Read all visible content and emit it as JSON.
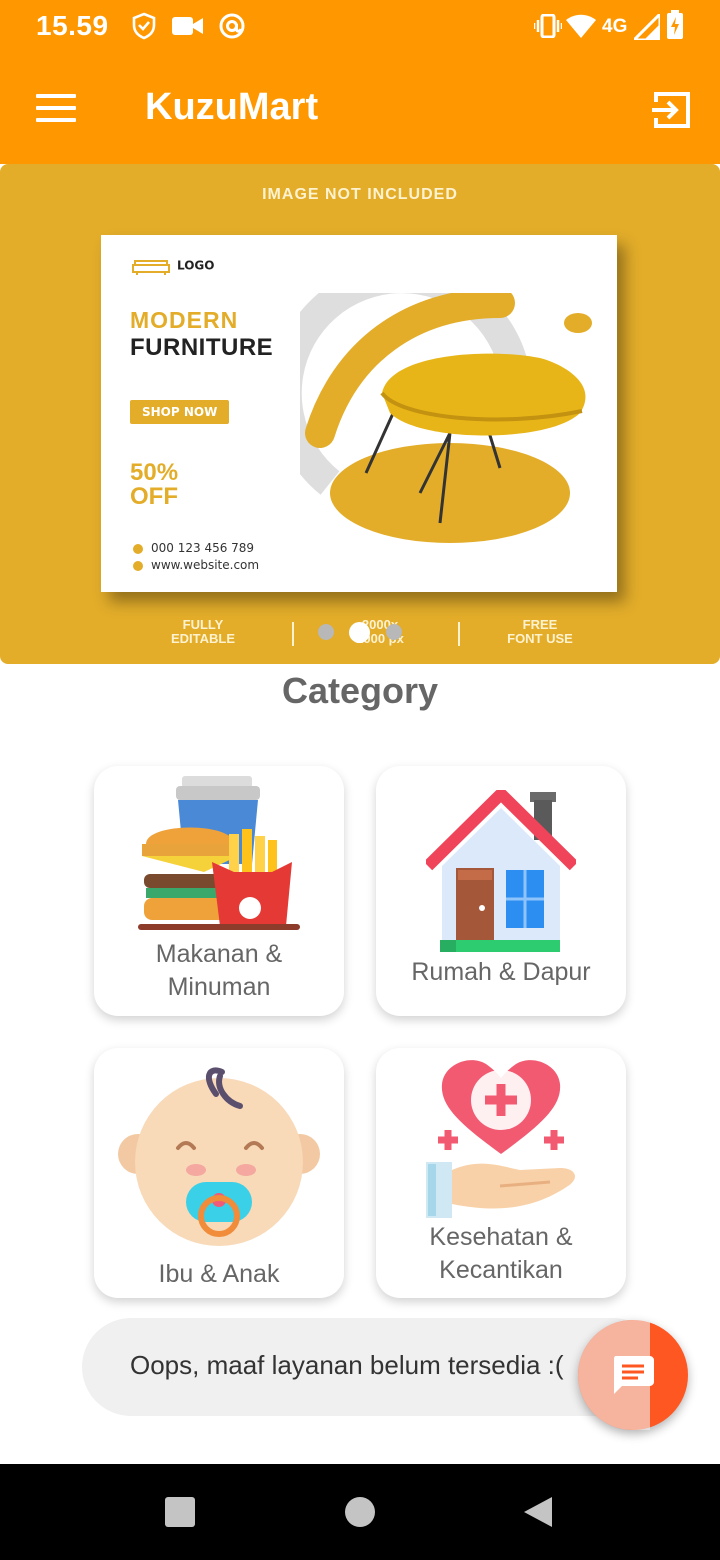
{
  "status_bar": {
    "time": "15.59",
    "network": "4G",
    "icons": [
      "shield-icon",
      "video-camera-icon",
      "at-sign-icon",
      "vibrate-icon",
      "wifi-icon",
      "signal-icon",
      "battery-charging-icon"
    ]
  },
  "app_bar": {
    "title": "KuzuMart",
    "menu_icon": "hamburger-menu-icon",
    "action_icon": "exit-to-app-icon"
  },
  "banner": {
    "top_text": "IMAGE NOT INCLUDED",
    "logo_text": "LOGO",
    "headline_1": "MODERN",
    "headline_2": "FURNITURE",
    "shop_button": "SHOP NOW",
    "discount_1": "50%",
    "discount_2": "OFF",
    "phone": "000 123 456 789",
    "website": "www.website.com",
    "footer_left": [
      "FULLY",
      "EDITABLE"
    ],
    "footer_mid": [
      "2000x",
      "2000 px"
    ],
    "footer_right": [
      "FREE",
      "FONT USE"
    ],
    "accent_color": "#e3ad2a",
    "slide_count": 3,
    "active_slide": 2
  },
  "category": {
    "title": "Category",
    "items": [
      {
        "label_1": "Makanan &",
        "label_2": "Minuman",
        "icon": "food-drink-icon"
      },
      {
        "label_1": "Rumah & Dapur",
        "label_2": "",
        "icon": "house-icon"
      },
      {
        "label_1": "Ibu & Anak",
        "label_2": "",
        "icon": "baby-icon"
      },
      {
        "label_1": "Kesehatan &",
        "label_2": "Kecantikan",
        "icon": "health-heart-icon"
      }
    ]
  },
  "toast": {
    "message": "Oops, maaf layanan belum tersedia :("
  },
  "fab": {
    "icon": "chat-message-icon",
    "color": "#ff5722"
  },
  "theme": {
    "primary": "#ff9800"
  },
  "nav_bar": {
    "buttons": [
      "recents-square-icon",
      "home-circle-icon",
      "back-triangle-icon"
    ]
  }
}
